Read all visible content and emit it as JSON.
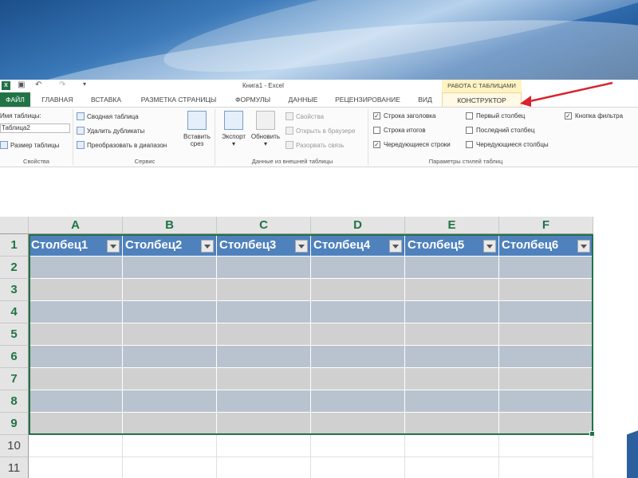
{
  "window": {
    "title": "Книга1 - Excel"
  },
  "contextual_tab_group": "РАБОТА С ТАБЛИЦАМИ",
  "tabs": [
    "ФАЙЛ",
    "ГЛАВНАЯ",
    "ВСТАВКА",
    "РАЗМЕТКА СТРАНИЦЫ",
    "ФОРМУЛЫ",
    "ДАННЫЕ",
    "РЕЦЕНЗИРОВАНИЕ",
    "ВИД",
    "КОНСТРУКТОР"
  ],
  "ribbon": {
    "properties": {
      "name_label": "Имя таблицы:",
      "name_value": "Таблица2",
      "resize": "Размер таблицы",
      "group": "Свойства"
    },
    "tools": {
      "pivot": "Сводная таблица",
      "remove_dupes": "Удалить дубликаты",
      "convert": "Преобразовать в диапазон",
      "slicer_line1": "Вставить",
      "slicer_line2": "срез",
      "group": "Сервис"
    },
    "external": {
      "export": "Экспорт",
      "refresh": "Обновить",
      "properties": "Свойства",
      "open_browser": "Открыть в браузере",
      "unlink": "Разорвать связь",
      "group": "Данные из внешней таблицы"
    },
    "style_options": {
      "header_row": {
        "label": "Строка заголовка",
        "checked": true
      },
      "total_row": {
        "label": "Строка итогов",
        "checked": false
      },
      "banded_rows": {
        "label": "Чередующиеся строки",
        "checked": true
      },
      "first_column": {
        "label": "Первый столбец",
        "checked": false
      },
      "last_column": {
        "label": "Последний столбец",
        "checked": false
      },
      "banded_columns": {
        "label": "Чередующиеся столбцы",
        "checked": false
      },
      "filter_button": {
        "label": "Кнопка фильтра",
        "checked": true
      },
      "group": "Параметры стилей таблиц"
    }
  },
  "sheet": {
    "columns": [
      "A",
      "B",
      "C",
      "D",
      "E",
      "F"
    ],
    "rows": [
      "1",
      "2",
      "3",
      "4",
      "5",
      "6",
      "7",
      "8",
      "9",
      "10",
      "11"
    ],
    "table_headers": [
      "Столбец1",
      "Столбец2",
      "Столбец3",
      "Столбец4",
      "Столбец5",
      "Столбец6"
    ]
  },
  "colors": {
    "excel_green": "#217346",
    "table_header": "#4f81bd",
    "band_blue": "#b8c3cf",
    "band_gray": "#d0d0d0",
    "arrow": "#d9232d"
  }
}
